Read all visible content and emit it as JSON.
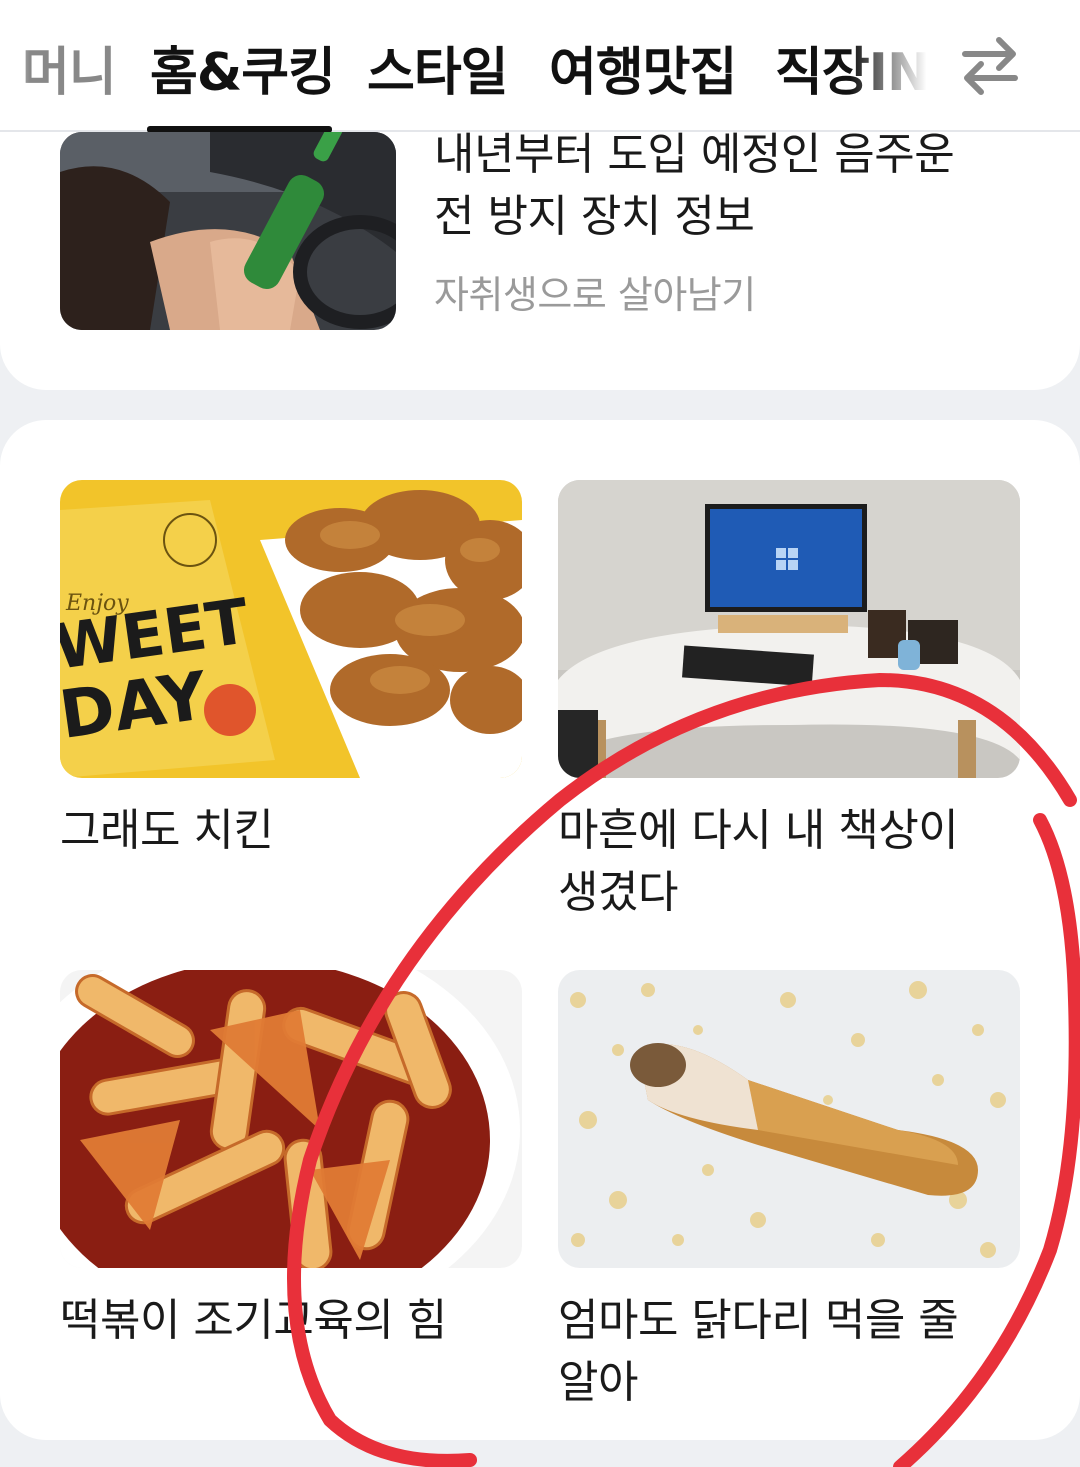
{
  "tabs": [
    {
      "label": "머니"
    },
    {
      "label": "홈&쿠킹"
    },
    {
      "label": "스타일"
    },
    {
      "label": "여행맛집"
    },
    {
      "label": "직장IN"
    }
  ],
  "active_tab_index": 1,
  "top_article": {
    "title_line1": "내년부터 도입 예정인 음주운",
    "title_line2": "전 방지 장치 정보",
    "source": "자취생으로 살아남기"
  },
  "grid_articles": [
    {
      "title_line1": "그래도 치킨",
      "title_line2": ""
    },
    {
      "title_line1": "마흔에 다시 내 책상이",
      "title_line2": "생겼다"
    },
    {
      "title_line1": "떡볶이 조기교육의 힘",
      "title_line2": ""
    },
    {
      "title_line1": "엄마도 닭다리 먹을 줄",
      "title_line2": "알아"
    }
  ],
  "thumb_texts": {
    "box_enjoy": "Enjoy",
    "box_sweet": "WEET",
    "box_day": "DAY"
  },
  "colors": {
    "annotation_circle": "#e8303a",
    "active_tab": "#111111"
  }
}
